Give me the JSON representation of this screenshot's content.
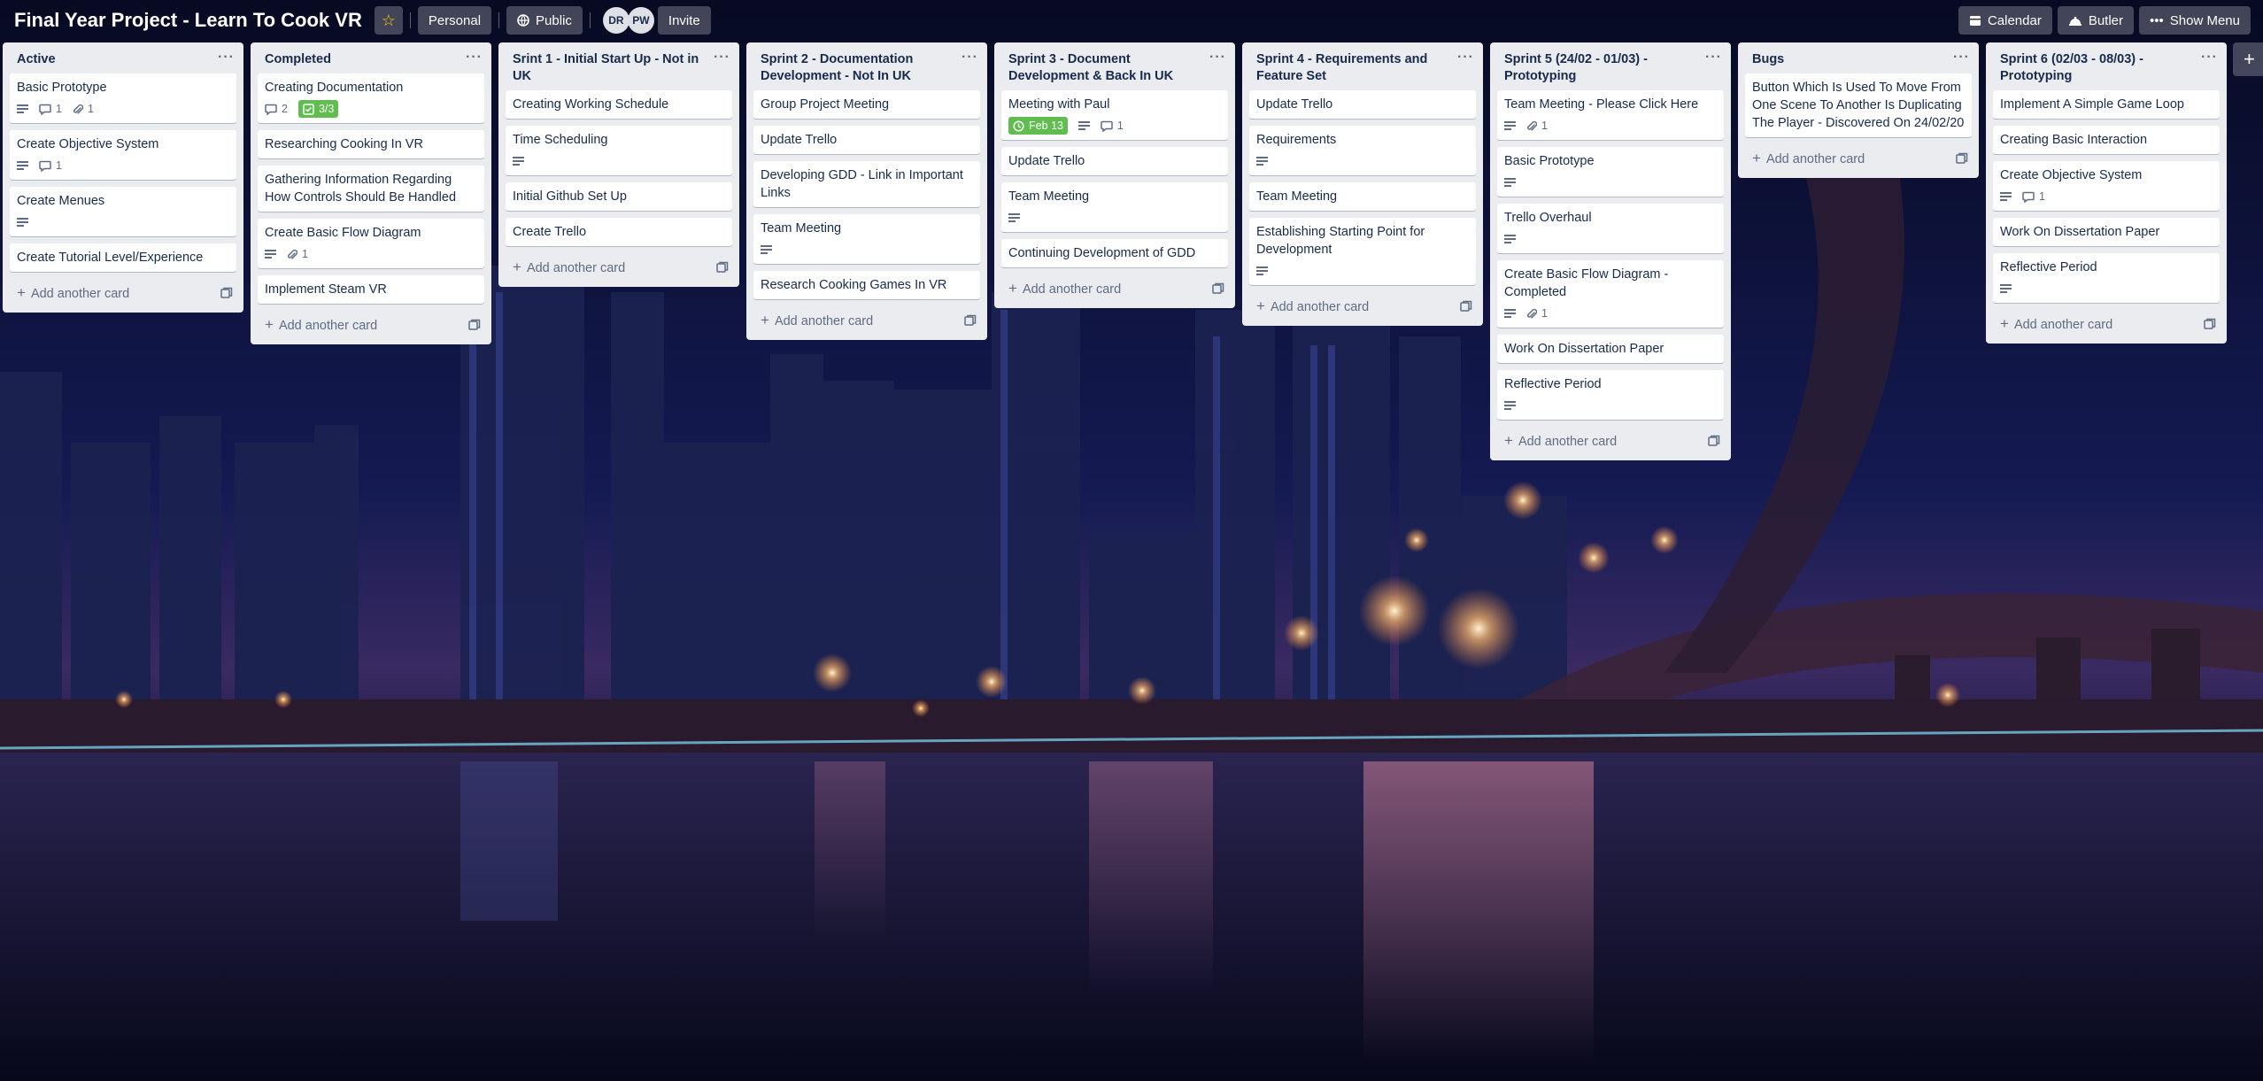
{
  "board": {
    "title": "Final Year Project - Learn To Cook VR",
    "visibility_team": "Personal",
    "visibility_public": "Public",
    "members": [
      "DR",
      "PW"
    ],
    "invite_label": "Invite",
    "star_icon": "star-icon"
  },
  "header_right": {
    "calendar": "Calendar",
    "butler": "Butler",
    "show_menu": "Show Menu"
  },
  "add_card_label": "Add another card",
  "lists": [
    {
      "title": "Active",
      "cards": [
        {
          "title": "Basic Prototype",
          "description": true,
          "comments": "1",
          "attachments": "1"
        },
        {
          "title": "Create Objective System",
          "description": true,
          "comments": "1"
        },
        {
          "title": "Create Menues",
          "description": true
        },
        {
          "title": "Create Tutorial Level/Experience"
        }
      ]
    },
    {
      "title": "Completed",
      "cards": [
        {
          "title": "Creating Documentation",
          "comments": "2",
          "checklist": "3/3"
        },
        {
          "title": "Researching Cooking In VR"
        },
        {
          "title": "Gathering Information Regarding How Controls Should Be Handled"
        },
        {
          "title": "Create Basic Flow Diagram",
          "description": true,
          "attachments": "1"
        },
        {
          "title": "Implement Steam VR"
        }
      ]
    },
    {
      "title": "Srint 1 - Initial Start Up - Not in UK",
      "cards": [
        {
          "title": "Creating Working Schedule"
        },
        {
          "title": "Time Scheduling",
          "description": true
        },
        {
          "title": "Initial Github Set Up"
        },
        {
          "title": "Create Trello"
        }
      ]
    },
    {
      "title": "Sprint 2 - Documentation Development - Not In UK",
      "cards": [
        {
          "title": "Group Project Meeting"
        },
        {
          "title": "Update Trello"
        },
        {
          "title": "Developing GDD - Link in Important Links"
        },
        {
          "title": "Team Meeting",
          "description": true
        },
        {
          "title": "Research Cooking Games In VR"
        }
      ]
    },
    {
      "title": "Sprint 3 - Document Development & Back In UK",
      "cards": [
        {
          "title": "Meeting with Paul",
          "due": "Feb 13",
          "description": true,
          "comments": "1"
        },
        {
          "title": "Update Trello"
        },
        {
          "title": "Team Meeting",
          "description": true
        },
        {
          "title": "Continuing Development of GDD"
        }
      ]
    },
    {
      "title": "Sprint 4 - Requirements and Feature Set",
      "cards": [
        {
          "title": "Update Trello"
        },
        {
          "title": "Requirements",
          "description": true
        },
        {
          "title": "Team Meeting"
        },
        {
          "title": "Establishing Starting Point for Development",
          "description": true
        }
      ]
    },
    {
      "title": "Sprint 5 (24/02 - 01/03) - Prototyping",
      "cards": [
        {
          "title": "Team Meeting - Please Click Here",
          "description": true,
          "attachments": "1"
        },
        {
          "title": "Basic Prototype",
          "description": true
        },
        {
          "title": "Trello Overhaul",
          "description": true
        },
        {
          "title": "Create Basic Flow Diagram - Completed",
          "description": true,
          "attachments": "1"
        },
        {
          "title": "Work On Dissertation Paper"
        },
        {
          "title": "Reflective Period",
          "description": true
        }
      ]
    },
    {
      "title": "Bugs",
      "cards": [
        {
          "title": "Button Which Is Used To Move From One Scene To Another Is Duplicating The Player - Discovered On 24/02/20"
        }
      ]
    },
    {
      "title": "Sprint 6 (02/03 - 08/03) - Prototyping",
      "cards": [
        {
          "title": "Implement A Simple Game Loop"
        },
        {
          "title": "Creating Basic Interaction"
        },
        {
          "title": "Create Objective System",
          "description": true,
          "comments": "1"
        },
        {
          "title": "Work On Dissertation Paper"
        },
        {
          "title": "Reflective Period",
          "description": true
        }
      ]
    }
  ]
}
